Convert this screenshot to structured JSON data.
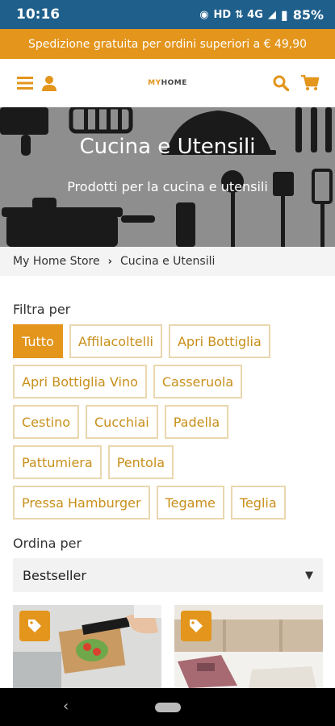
{
  "status": {
    "time": "10:16",
    "network": "HD ⇅ 4G",
    "battery": "85%"
  },
  "promo": {
    "text": "Spedizione gratuita per ordini superiori a € 49,90"
  },
  "header": {
    "logo_my": "MY",
    "logo_home": "HOME",
    "icons": [
      "menu-icon",
      "user-icon",
      "search-icon",
      "cart-icon"
    ]
  },
  "hero": {
    "title": "Cucina e Utensili",
    "subtitle": "Prodotti per la cucina e utensili"
  },
  "breadcrumb": {
    "home": "My Home Store",
    "current": "Cucina e Utensili"
  },
  "filter": {
    "label": "Filtra per",
    "chips": [
      "Tutto",
      "Affilacoltelli",
      "Apri Bottiglia",
      "Apri Bottiglia Vino",
      "Casseruola",
      "Cestino",
      "Cucchiai",
      "Padella",
      "Pattumiera",
      "Pentola",
      "Pressa Hamburger",
      "Tegame",
      "Teglia"
    ],
    "active": "Tutto"
  },
  "sort": {
    "label": "Ordina per",
    "selected": "Bestseller"
  },
  "colors": {
    "accent": "#e3951c",
    "status_bar": "#1f5f8b"
  }
}
